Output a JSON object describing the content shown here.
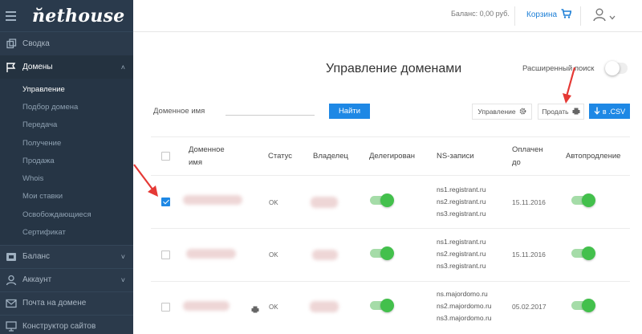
{
  "app": {
    "logo": "n̆ethouse"
  },
  "sidebar": {
    "items": [
      {
        "label": "Сводка",
        "icon": "copy-icon"
      },
      {
        "label": "Домены",
        "icon": "flag-icon"
      }
    ],
    "domains_sub": [
      "Управление",
      "Подбор домена",
      "Передача",
      "Получение",
      "Продажа",
      "Whois",
      "Мои ставки",
      "Освобождающиеся",
      "Сертификат"
    ],
    "bottom": [
      {
        "label": "Баланс",
        "icon": "wallet-icon"
      },
      {
        "label": "Аккаунт",
        "icon": "user-icon"
      },
      {
        "label": "Почта на домене",
        "icon": "mail-icon"
      },
      {
        "label": "Конструктор сайтов",
        "icon": "monitor-icon"
      }
    ]
  },
  "header": {
    "balance": "Баланс: 0,00 руб.",
    "cart": "Корзина"
  },
  "main": {
    "title": "Управление доменами",
    "advanced_search": "Расширенный поиск",
    "filter_label": "Доменное имя",
    "filter_value": "",
    "find_button": "Найти",
    "manage_button": "Управление",
    "sell_button": "Продать",
    "csv_button": "в .CSV"
  },
  "table": {
    "headers": {
      "domain_line1": "Доменное",
      "domain_line2": "имя",
      "status": "Статус",
      "owner": "Владелец",
      "delegated": "Делегирован",
      "ns": "NS-записи",
      "paid_line1": "Оплачен",
      "paid_line2": "до",
      "autorenew": "Автопродление"
    },
    "rows": [
      {
        "checked": true,
        "status": "OK",
        "ns": [
          "ns1.registrant.ru",
          "ns2.registrant.ru",
          "ns3.registrant.ru"
        ],
        "paid": "15.11.2016",
        "delegated": true,
        "autorenew": true
      },
      {
        "checked": false,
        "status": "OK",
        "ns": [
          "ns1.registrant.ru",
          "ns2.registrant.ru",
          "ns3.registrant.ru"
        ],
        "paid": "15.11.2016",
        "delegated": true,
        "autorenew": true
      },
      {
        "checked": false,
        "status": "OK",
        "ns": [
          "ns.majordomo.ru",
          "ns2.majordomo.ru",
          "ns3.majordomo.ru"
        ],
        "paid": "05.02.2017",
        "delegated": true,
        "autorenew": true
      }
    ]
  },
  "colors": {
    "sidebar": "#2b3a4b",
    "accent": "#1e88e5",
    "switch_on": "#43c04c",
    "arrow": "#e53935"
  }
}
